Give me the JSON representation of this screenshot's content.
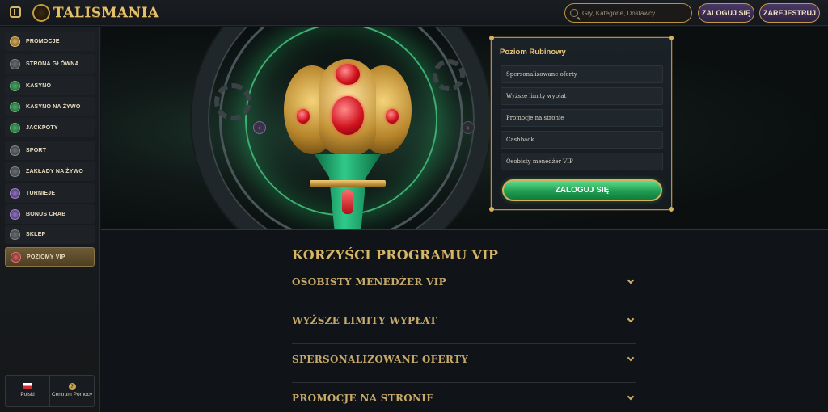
{
  "header": {
    "logo_text": "TALISMANIA",
    "search_placeholder": "Gry, Kategorie, Dostawcy",
    "login_label": "ZALOGUJ SIĘ",
    "register_label": "ZAREJESTRUJ"
  },
  "sidebar": {
    "items": [
      {
        "label": "PROMOCJE",
        "icon": "gift-icon"
      },
      {
        "label": "STRONA GŁÓWNA",
        "icon": "home-icon"
      },
      {
        "label": "KASYNO",
        "icon": "casino-chip-icon"
      },
      {
        "label": "KASYNO NA ŻYWO",
        "icon": "live-casino-icon"
      },
      {
        "label": "JACKPOTY",
        "icon": "clover-icon"
      },
      {
        "label": "SPORT",
        "icon": "soccer-ball-icon"
      },
      {
        "label": "ZAKŁADY NA ŻYWO",
        "icon": "live-bets-icon"
      },
      {
        "label": "TURNIEJE",
        "icon": "trophy-icon"
      },
      {
        "label": "BONUS CRAB",
        "icon": "crab-icon"
      },
      {
        "label": "SKLEP",
        "icon": "shop-icon"
      },
      {
        "label": "POZIOMY VIP",
        "icon": "diamond-icon"
      }
    ],
    "footer": {
      "language_label": "Polski",
      "help_label": "Centrum Pomocy"
    }
  },
  "vip_card": {
    "title": "Poziom Rubinowy",
    "benefits": [
      "Spersonalizowane oferty",
      "Wyższe limity wypłat",
      "Promocje na stronie",
      "Cashback",
      "Osobisty menedżer VIP"
    ],
    "login_label": "ZALOGUJ SIĘ"
  },
  "benefits_section": {
    "title": "KORZYŚCI PROGRAMU VIP",
    "items": [
      "OSOBISTY MENEDŻER VIP",
      "WYŻSZE LIMITY WYPŁAT",
      "SPERSONALIZOWANE OFERTY",
      "PROMOCJE NA STRONIE"
    ]
  },
  "colors": {
    "accent_gold": "#d6b565",
    "button_purple": "#4a3866",
    "cta_green": "#1f9e52"
  }
}
